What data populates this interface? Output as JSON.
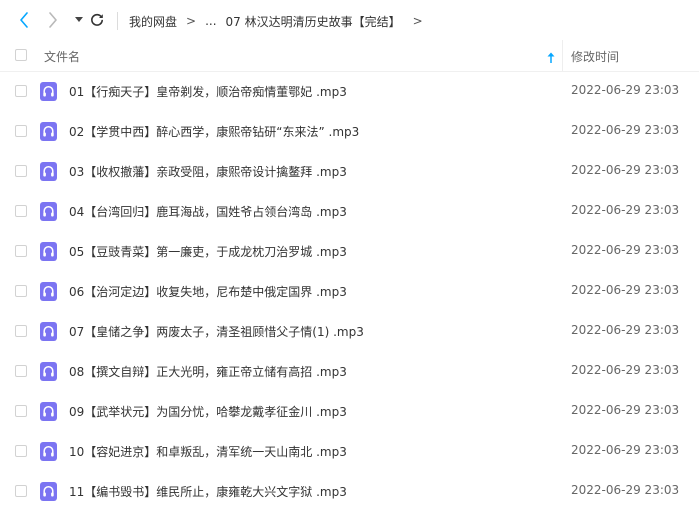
{
  "breadcrumb": {
    "root": "我的网盘",
    "separator": ">",
    "ellipsis": "...",
    "current": "07 林汉达明清历史故事【完结】",
    "tail": ">"
  },
  "columns": {
    "name": "文件名",
    "modified": "修改时间"
  },
  "colors": {
    "accent": "#06a7ff",
    "file_icon": "#7b74f2"
  },
  "files": [
    {
      "name": "01【行痴天子】皇帝剃发，顺治帝痴情董鄂妃 .mp3",
      "modified": "2022-06-29 23:03",
      "icon": "audio-file-icon"
    },
    {
      "name": "02【学贯中西】醉心西学，康熙帝钻研“东来法” .mp3",
      "modified": "2022-06-29 23:03",
      "icon": "audio-file-icon"
    },
    {
      "name": "03【收权撤藩】亲政受阻，康熙帝设计擒鳌拜 .mp3",
      "modified": "2022-06-29 23:03",
      "icon": "audio-file-icon"
    },
    {
      "name": "04【台湾回归】鹿耳海战，国姓爷占领台湾岛 .mp3",
      "modified": "2022-06-29 23:03",
      "icon": "audio-file-icon"
    },
    {
      "name": "05【豆豉青菜】第一廉吏，于成龙枕刀治罗城 .mp3",
      "modified": "2022-06-29 23:03",
      "icon": "audio-file-icon"
    },
    {
      "name": "06【治河定边】收复失地，尼布楚中俄定国界 .mp3",
      "modified": "2022-06-29 23:03",
      "icon": "audio-file-icon"
    },
    {
      "name": "07【皇储之争】两废太子，清圣祖顾惜父子情(1) .mp3",
      "modified": "2022-06-29 23:03",
      "icon": "audio-file-icon"
    },
    {
      "name": "08【撰文自辩】正大光明，雍正帝立储有高招 .mp3",
      "modified": "2022-06-29 23:03",
      "icon": "audio-file-icon"
    },
    {
      "name": "09【武举状元】为国分忧，哈攀龙戴孝征金川 .mp3",
      "modified": "2022-06-29 23:03",
      "icon": "audio-file-icon"
    },
    {
      "name": "10【容妃进京】和卓叛乱，清军统一天山南北 .mp3",
      "modified": "2022-06-29 23:03",
      "icon": "audio-file-icon"
    },
    {
      "name": "11【编书毁书】维民所止，康雍乾大兴文字狱 .mp3",
      "modified": "2022-06-29 23:03",
      "icon": "audio-file-icon"
    }
  ]
}
